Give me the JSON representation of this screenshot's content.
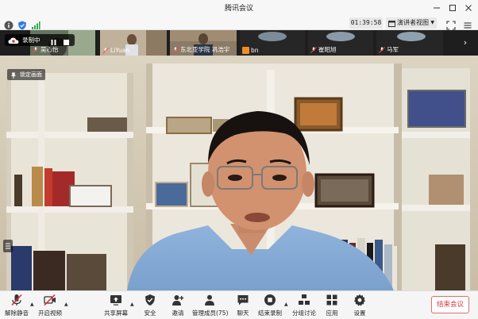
{
  "window": {
    "title": "腾讯会议"
  },
  "status": {
    "timer": "01:39:58",
    "view_mode": "演讲者视图"
  },
  "recording": {
    "label": "录制中"
  },
  "gallery": {
    "participants": [
      {
        "name": "吴心怡"
      },
      {
        "name": "LiYuan"
      },
      {
        "name": "东北亚学院 巩浩宇"
      },
      {
        "name": "bn"
      },
      {
        "name": "崔昭旭"
      },
      {
        "name": "马军"
      }
    ]
  },
  "video": {
    "lock_label": "锁定画面"
  },
  "toolbar": {
    "unmute": "解除静音",
    "start_video": "开启视频",
    "share_screen": "共享屏幕",
    "security": "安全",
    "invite": "邀请",
    "manage_members": "管理成员(75)",
    "chat": "聊天",
    "end_recording": "结束录制",
    "breakout": "分组讨论",
    "apps": "应用",
    "settings": "设置",
    "end_meeting": "结束会议"
  },
  "colors": {
    "accent_red": "#d9363e",
    "toolbar_bg": "#f5f5f5",
    "gallery_bg": "#1e1e1e"
  }
}
